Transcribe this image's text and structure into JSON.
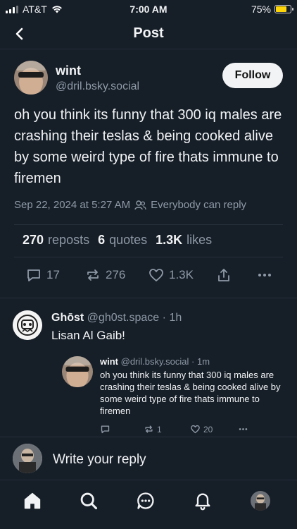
{
  "status_bar": {
    "carrier": "AT&T",
    "time": "7:00 AM",
    "battery": "75%",
    "battery_level": 0.75
  },
  "header": {
    "title": "Post"
  },
  "post": {
    "author_name": "wint",
    "author_handle": "@dril.bsky.social",
    "follow_label": "Follow",
    "text": "oh you think its funny that 300 iq males are crashing their teslas & being cooked alive by some weird type of fire thats immune to firemen",
    "timestamp": "Sep 22, 2024 at 5:27 AM",
    "reply_setting": "Everybody can reply",
    "stats": {
      "reposts_count": "270",
      "reposts_label": "reposts",
      "quotes_count": "6",
      "quotes_label": "quotes",
      "likes_count": "1.3K",
      "likes_label": "likes"
    },
    "actions": {
      "replies": "17",
      "reposts": "276",
      "likes": "1.3K"
    }
  },
  "reply": {
    "author_name": "Ghōst",
    "author_handle": "@gh0st.space",
    "separator": "·",
    "time": "1h",
    "text": "Lisan Al Gaib!",
    "quote": {
      "author_name": "wint",
      "author_handle": "@dril.bsky.social",
      "separator": "·",
      "time": "1m",
      "text": "oh you think its funny that 300 iq males are crashing their teslas & being cooked alive by some weird type of fire thats immune to firemen",
      "reposts": "1",
      "likes": "20"
    }
  },
  "compose": {
    "placeholder": "Write your reply"
  },
  "colors": {
    "background": "#161e27",
    "text": "#f1f3f5",
    "muted": "#8e9aa8",
    "divider": "#26313d",
    "battery": "#ffd60a"
  },
  "icons": {
    "status": [
      "signal-icon",
      "wifi-icon",
      "battery-icon"
    ],
    "header": [
      "back-chevron-icon"
    ],
    "post_actions": [
      "reply-icon",
      "repost-icon",
      "like-icon",
      "share-icon",
      "more-icon"
    ],
    "tabs": [
      "home-icon",
      "search-icon",
      "chat-icon",
      "notifications-icon",
      "profile-avatar"
    ]
  }
}
